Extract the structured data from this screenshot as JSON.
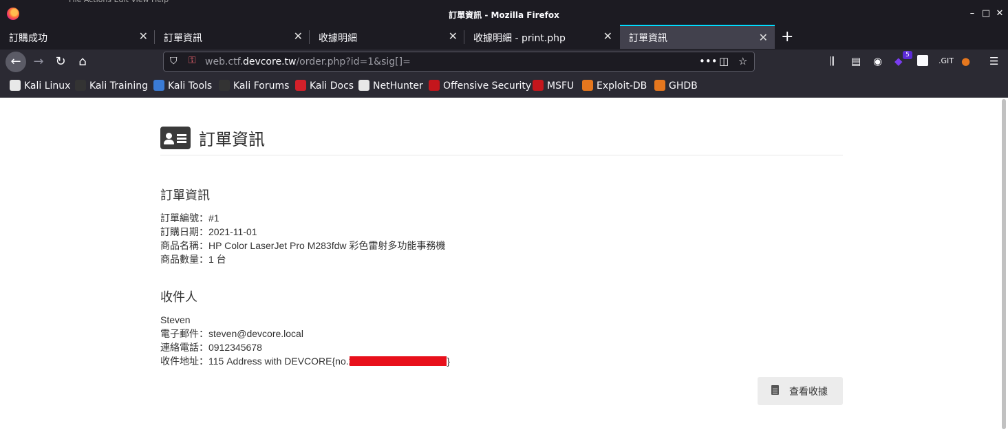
{
  "browser": {
    "window_title": "訂單資訊 - Mozilla Firefox",
    "menu_strip": "File   Actions   Edit   View   Help",
    "tabs": [
      {
        "label": "訂購成功",
        "active": false
      },
      {
        "label": "訂單資訊",
        "active": false
      },
      {
        "label": "收據明細",
        "active": false
      },
      {
        "label": "收據明細 - print.php",
        "active": false
      },
      {
        "label": "訂單資訊",
        "active": true
      }
    ],
    "url_domain_prefix": "web.ctf.",
    "url_domain": "devcore.tw",
    "url_path": "/order.php?id=1&sig[]=",
    "extension_badge": "5",
    "bookmarks": [
      {
        "label": "Kali Linux",
        "icon": "kali-icon",
        "color": "#e8e8e8"
      },
      {
        "label": "Kali Training",
        "icon": "kali-training-icon",
        "color": "#333333"
      },
      {
        "label": "Kali Tools",
        "icon": "kali-tools-icon",
        "color": "#3a7bd5"
      },
      {
        "label": "Kali Forums",
        "icon": "kali-forums-icon",
        "color": "#333333"
      },
      {
        "label": "Kali Docs",
        "icon": "kali-docs-icon",
        "color": "#d4202a"
      },
      {
        "label": "NetHunter",
        "icon": "nethunter-icon",
        "color": "#e8e8e8"
      },
      {
        "label": "Offensive Security",
        "icon": "offsec-icon",
        "color": "#c4161c"
      },
      {
        "label": "MSFU",
        "icon": "msfu-icon",
        "color": "#c4161c"
      },
      {
        "label": "Exploit-DB",
        "icon": "exploitdb-icon",
        "color": "#e5771e"
      },
      {
        "label": "GHDB",
        "icon": "ghdb-icon",
        "color": "#e5771e"
      }
    ]
  },
  "page": {
    "title": "訂單資訊",
    "order_section": {
      "heading": "訂單資訊",
      "lines": [
        "訂單編號：#1",
        "訂購日期：2021-11-01",
        "商品名稱：HP Color LaserJet Pro M283fdw 彩色雷射多功能事務機",
        "商品數量：1 台"
      ]
    },
    "recipient_section": {
      "heading": "收件人",
      "name": "Steven",
      "email_line": "電子郵件：steven@devcore.local",
      "phone_line": "連絡電話：0912345678",
      "address_prefix": "收件地址：115 Address with DEVCORE{no.2",
      "address_suffix": "}"
    },
    "receipt_button": "查看收據"
  }
}
